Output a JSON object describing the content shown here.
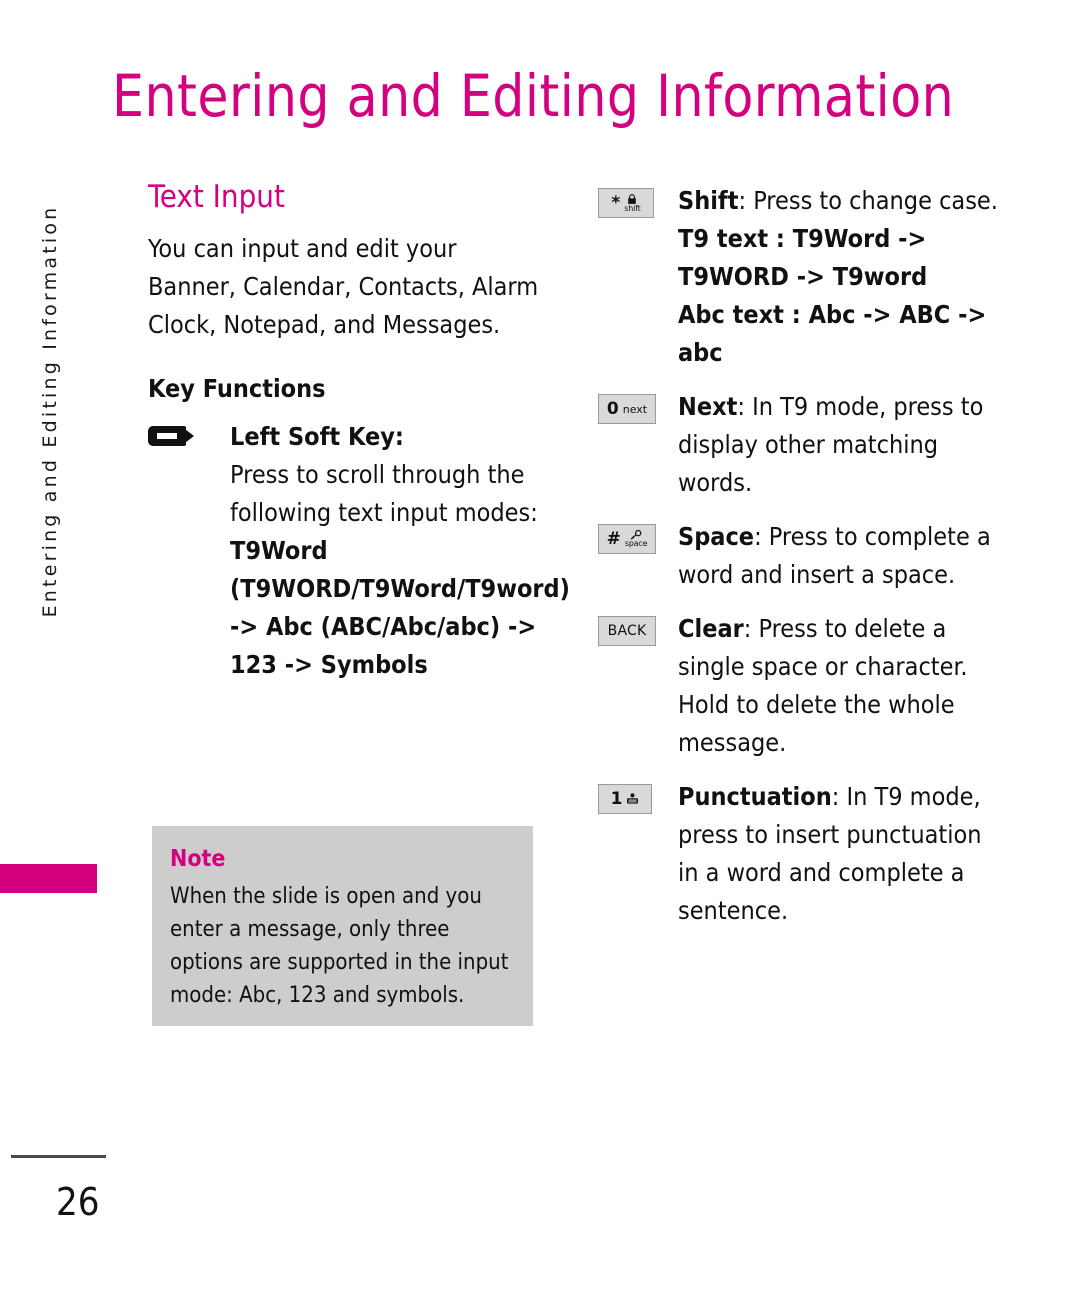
{
  "document": {
    "page_title": "Entering and Editing Information",
    "side_tab_label": "Entering and Editing Information",
    "page_number": "26",
    "accent_color": "#d4007f",
    "note_background": "#cdcdcd",
    "text_color": "#111111"
  },
  "left_column": {
    "section_title": "Text Input",
    "intro_paragraph": "You can input and edit your Banner, Calendar, Contacts, Alarm Clock, Notepad, and Messages.",
    "sub_title": "Key Functions",
    "soft_key": {
      "icon": "left-soft-key-icon",
      "label": "Left Soft Key:",
      "description_plain": "Press to scroll through the following text input modes: ",
      "description_bold": "T9Word (T9WORD/T9Word/T9word) -> Abc (ABC/Abc/abc) -> 123 -> Symbols"
    }
  },
  "note": {
    "title": "Note",
    "body": "When the slide is open and you enter a message, only three options are supported in the input mode: Abc, 123 and symbols."
  },
  "right_column": {
    "items": [
      {
        "key_icon": "star-shift-key-icon",
        "key_primary": "*",
        "key_secondary": "shift",
        "key_glyph": "lock-glyph",
        "label": "Shift",
        "separator": ": ",
        "description": "Press to change case.",
        "extra_bold_lines": [
          "T9 text : T9Word -> T9WORD -> T9word",
          "Abc text : Abc -> ABC -> abc"
        ]
      },
      {
        "key_icon": "zero-next-key-icon",
        "key_primary": "0",
        "key_secondary": "next",
        "label": "Next",
        "separator": ": ",
        "description": "In T9 mode, press to display other matching words."
      },
      {
        "key_icon": "hash-space-key-icon",
        "key_primary": "#",
        "key_secondary": "space",
        "key_glyph": "key-glyph",
        "label": "Space",
        "separator": ": ",
        "description": "Press to complete a word and insert a space."
      },
      {
        "key_icon": "back-key-icon",
        "key_primary": "BACK",
        "label": "Clear",
        "separator": ": ",
        "description": "Press to delete a single space or character. Hold to delete the whole message."
      },
      {
        "key_icon": "one-voicemail-key-icon",
        "key_primary": "1",
        "key_glyph": "voicemail-glyph",
        "label": "Punctuation",
        "separator": ": ",
        "description": "In T9 mode, press to insert punctuation in a word and complete a sentence."
      }
    ]
  }
}
